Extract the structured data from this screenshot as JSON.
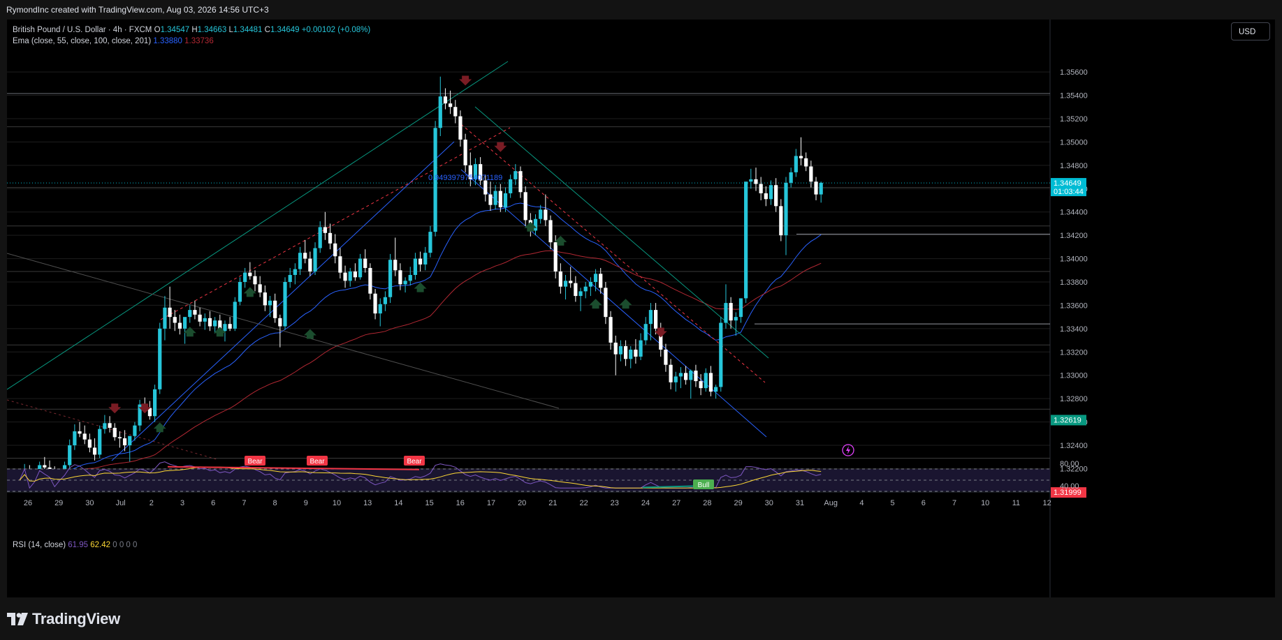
{
  "header": {
    "attribution": "RymondInc created with TradingView.com, Aug 03, 2026 14:56 UTC+3"
  },
  "legend": {
    "symbol": "British Pound / U.S. Dollar · 4h · FXCM",
    "o_label": "O",
    "o": "1.34547",
    "h_label": "H",
    "h": "1.34663",
    "l_label": "L",
    "l": "1.34481",
    "c_label": "C",
    "c": "1.34649",
    "change": "+0.00102 (+0.08%)",
    "ema_label": "Ema (close, 55, close, 100, close, 201)",
    "ema1": "1.33880",
    "ema2": "1.33736"
  },
  "rsi_legend": {
    "label": "RSI (14, close)",
    "v1": "61.95",
    "v2": "62.42",
    "v3": "0  0  0  0"
  },
  "currency_button": "USD",
  "colors": {
    "bull": "#26c6da",
    "bear": "#ffffff",
    "ema55": "#2962ff",
    "ema100": "#b22833",
    "rsi": "#7e57c2",
    "rsi_ma": "#fdd835",
    "accent_green": "#089981",
    "accent_red": "#f23645"
  },
  "footer": {
    "brand": "TradingView"
  },
  "chart_data": {
    "type": "candlestick",
    "price_scale": {
      "min": 1.3185,
      "max": 1.3575,
      "ticks": [
        "1.35600",
        "1.35400",
        "1.35200",
        "1.35000",
        "1.34800",
        "1.34600",
        "1.34400",
        "1.34200",
        "1.34000",
        "1.33800",
        "1.33600",
        "1.33400",
        "1.33200",
        "1.33000",
        "1.32800",
        "1.32600",
        "1.32400",
        "1.32200"
      ]
    },
    "price_labels": [
      {
        "text": "1.34649",
        "sub": "01:03:44",
        "value": 1.34649,
        "color": "#00bcd4"
      },
      {
        "text": "1.32619",
        "value": 1.32619,
        "color": "#089981"
      },
      {
        "text": "1.31999",
        "value": 1.31999,
        "color": "#f23645"
      }
    ],
    "rsi_scale": {
      "ticks": [
        "80.00",
        "40.00"
      ]
    },
    "x_ticks": [
      "26",
      "29",
      "30",
      "Jul",
      "2",
      "3",
      "6",
      "7",
      "8",
      "9",
      "10",
      "13",
      "14",
      "15",
      "16",
      "17",
      "20",
      "21",
      "22",
      "23",
      "24",
      "27",
      "28",
      "29",
      "30",
      "31",
      "Aug",
      "4",
      "5",
      "6",
      "7",
      "10",
      "11",
      "12"
    ],
    "annotation_text": "0.9493979754071189",
    "rsi_signals": [
      {
        "text": "Bear",
        "index": 70
      },
      {
        "text": "Bear",
        "index": 88
      },
      {
        "text": "Bear",
        "index": 116
      },
      {
        "text": "Bull",
        "index": 200
      }
    ],
    "candles": [
      [
        1.3212,
        1.3219,
        1.3209,
        1.3216
      ],
      [
        1.3216,
        1.3224,
        1.3212,
        1.3219
      ],
      [
        1.3219,
        1.3223,
        1.3206,
        1.3211
      ],
      [
        1.3211,
        1.3218,
        1.3205,
        1.3215
      ],
      [
        1.3215,
        1.3226,
        1.3212,
        1.3223
      ],
      [
        1.3223,
        1.323,
        1.3217,
        1.3221
      ],
      [
        1.3221,
        1.3227,
        1.3214,
        1.3219
      ],
      [
        1.3219,
        1.3222,
        1.3205,
        1.321
      ],
      [
        1.321,
        1.3218,
        1.3207,
        1.3216
      ],
      [
        1.3216,
        1.3226,
        1.3213,
        1.3223
      ],
      [
        1.3223,
        1.3245,
        1.322,
        1.324
      ],
      [
        1.324,
        1.3258,
        1.3236,
        1.3252
      ],
      [
        1.3252,
        1.326,
        1.3247,
        1.325
      ],
      [
        1.325,
        1.3257,
        1.3241,
        1.3245
      ],
      [
        1.3245,
        1.325,
        1.3234,
        1.3238
      ],
      [
        1.3238,
        1.3246,
        1.3227,
        1.3232
      ],
      [
        1.3232,
        1.3257,
        1.3229,
        1.3254
      ],
      [
        1.3254,
        1.3266,
        1.325,
        1.3259
      ],
      [
        1.3259,
        1.3265,
        1.3251,
        1.3255
      ],
      [
        1.3255,
        1.3259,
        1.3244,
        1.3247
      ],
      [
        1.3247,
        1.3252,
        1.3238,
        1.3246
      ],
      [
        1.3246,
        1.3253,
        1.3235,
        1.324
      ],
      [
        1.324,
        1.3244,
        1.3226,
        1.3248
      ],
      [
        1.3248,
        1.326,
        1.3244,
        1.3257
      ],
      [
        1.3257,
        1.3279,
        1.3252,
        1.3275
      ],
      [
        1.3275,
        1.3281,
        1.3268,
        1.3272
      ],
      [
        1.3272,
        1.3278,
        1.3262,
        1.3265
      ],
      [
        1.3265,
        1.3292,
        1.326,
        1.3288
      ],
      [
        1.3288,
        1.3345,
        1.3284,
        1.334
      ],
      [
        1.334,
        1.3368,
        1.333,
        1.3358
      ],
      [
        1.3358,
        1.3376,
        1.334,
        1.335
      ],
      [
        1.335,
        1.3356,
        1.3338,
        1.3345
      ],
      [
        1.3345,
        1.3352,
        1.3335,
        1.334
      ],
      [
        1.334,
        1.3348,
        1.3327,
        1.335
      ],
      [
        1.335,
        1.336,
        1.3345,
        1.3356
      ],
      [
        1.3356,
        1.3364,
        1.3348,
        1.3352
      ],
      [
        1.3352,
        1.3358,
        1.3342,
        1.3346
      ],
      [
        1.3346,
        1.3353,
        1.3339,
        1.3349
      ],
      [
        1.3349,
        1.3355,
        1.3338,
        1.3342
      ],
      [
        1.3342,
        1.335,
        1.3336,
        1.3347
      ],
      [
        1.3347,
        1.3352,
        1.3334,
        1.3338
      ],
      [
        1.3338,
        1.3347,
        1.3329,
        1.3344
      ],
      [
        1.3344,
        1.335,
        1.3338,
        1.334
      ],
      [
        1.334,
        1.3367,
        1.3338,
        1.3363
      ],
      [
        1.3363,
        1.3384,
        1.336,
        1.338
      ],
      [
        1.338,
        1.3392,
        1.3375,
        1.3388
      ],
      [
        1.3388,
        1.3397,
        1.3382,
        1.3385
      ],
      [
        1.3385,
        1.339,
        1.3372,
        1.3378
      ],
      [
        1.3378,
        1.3385,
        1.3367,
        1.3371
      ],
      [
        1.3371,
        1.3377,
        1.3355,
        1.336
      ],
      [
        1.336,
        1.3368,
        1.335,
        1.3364
      ],
      [
        1.3364,
        1.337,
        1.3345,
        1.3349
      ],
      [
        1.3349,
        1.3352,
        1.3324,
        1.3342
      ],
      [
        1.3342,
        1.3384,
        1.3339,
        1.338
      ],
      [
        1.338,
        1.3392,
        1.3375,
        1.3386
      ],
      [
        1.3386,
        1.3396,
        1.3378,
        1.3391
      ],
      [
        1.3391,
        1.341,
        1.3386,
        1.3405
      ],
      [
        1.3405,
        1.3416,
        1.3396,
        1.34
      ],
      [
        1.34,
        1.3406,
        1.3385,
        1.3389
      ],
      [
        1.3389,
        1.3414,
        1.3386,
        1.3409
      ],
      [
        1.3409,
        1.3432,
        1.3405,
        1.3427
      ],
      [
        1.3427,
        1.344,
        1.3416,
        1.3422
      ],
      [
        1.3422,
        1.343,
        1.3408,
        1.3413
      ],
      [
        1.3413,
        1.3421,
        1.3396,
        1.3402
      ],
      [
        1.3402,
        1.3409,
        1.3383,
        1.3388
      ],
      [
        1.3388,
        1.3394,
        1.3375,
        1.3381
      ],
      [
        1.3381,
        1.3392,
        1.3376,
        1.3389
      ],
      [
        1.3389,
        1.3396,
        1.3381,
        1.3384
      ],
      [
        1.3384,
        1.3404,
        1.3382,
        1.34
      ],
      [
        1.34,
        1.3408,
        1.3388,
        1.3392
      ],
      [
        1.3392,
        1.3396,
        1.3365,
        1.337
      ],
      [
        1.337,
        1.3374,
        1.3348,
        1.3353
      ],
      [
        1.3353,
        1.3366,
        1.3342,
        1.3361
      ],
      [
        1.3361,
        1.3372,
        1.3355,
        1.3367
      ],
      [
        1.3367,
        1.3404,
        1.3362,
        1.3399
      ],
      [
        1.3399,
        1.3418,
        1.3385,
        1.339
      ],
      [
        1.339,
        1.3396,
        1.3373,
        1.3378
      ],
      [
        1.3378,
        1.3384,
        1.3371,
        1.3381
      ],
      [
        1.3381,
        1.3393,
        1.3377,
        1.3386
      ],
      [
        1.3386,
        1.3405,
        1.3382,
        1.34
      ],
      [
        1.34,
        1.3406,
        1.3389,
        1.3395
      ],
      [
        1.3395,
        1.341,
        1.339,
        1.3405
      ],
      [
        1.3405,
        1.3428,
        1.3401,
        1.3423
      ],
      [
        1.3423,
        1.3518,
        1.3419,
        1.3512
      ],
      [
        1.3512,
        1.3556,
        1.3505,
        1.3539
      ],
      [
        1.3539,
        1.3546,
        1.3528,
        1.3533
      ],
      [
        1.3533,
        1.3544,
        1.3524,
        1.353
      ],
      [
        1.353,
        1.3536,
        1.3516,
        1.3522
      ],
      [
        1.3522,
        1.3527,
        1.3496,
        1.3502
      ],
      [
        1.3502,
        1.3507,
        1.3474,
        1.348
      ],
      [
        1.348,
        1.3491,
        1.3462,
        1.3468
      ],
      [
        1.3468,
        1.3486,
        1.3463,
        1.3481
      ],
      [
        1.3481,
        1.3487,
        1.3463,
        1.3467
      ],
      [
        1.3467,
        1.3472,
        1.3449,
        1.3455
      ],
      [
        1.3455,
        1.3466,
        1.3441,
        1.3446
      ],
      [
        1.3446,
        1.3463,
        1.3442,
        1.3458
      ],
      [
        1.3458,
        1.3464,
        1.344,
        1.3444
      ],
      [
        1.3444,
        1.3461,
        1.344,
        1.3456
      ],
      [
        1.3456,
        1.3472,
        1.3452,
        1.3468
      ],
      [
        1.3468,
        1.3481,
        1.3463,
        1.3475
      ],
      [
        1.3475,
        1.3479,
        1.3452,
        1.3457
      ],
      [
        1.3457,
        1.3462,
        1.3428,
        1.3433
      ],
      [
        1.3433,
        1.3439,
        1.3419,
        1.3424
      ],
      [
        1.3424,
        1.3438,
        1.342,
        1.3434
      ],
      [
        1.3434,
        1.3446,
        1.343,
        1.3442
      ],
      [
        1.3442,
        1.3455,
        1.3428,
        1.3433
      ],
      [
        1.3433,
        1.3437,
        1.3408,
        1.3414
      ],
      [
        1.3414,
        1.342,
        1.3383,
        1.3389
      ],
      [
        1.3389,
        1.3396,
        1.337,
        1.3376
      ],
      [
        1.3376,
        1.3386,
        1.3365,
        1.3381
      ],
      [
        1.3381,
        1.3393,
        1.3375,
        1.3379
      ],
      [
        1.3379,
        1.3385,
        1.3363,
        1.3368
      ],
      [
        1.3368,
        1.3375,
        1.3355,
        1.3372
      ],
      [
        1.3372,
        1.338,
        1.3366,
        1.3376
      ],
      [
        1.3376,
        1.3384,
        1.3368,
        1.338
      ],
      [
        1.338,
        1.3391,
        1.3372,
        1.3387
      ],
      [
        1.3387,
        1.3392,
        1.337,
        1.3375
      ],
      [
        1.3375,
        1.338,
        1.3344,
        1.335
      ],
      [
        1.335,
        1.3355,
        1.3322,
        1.3328
      ],
      [
        1.3328,
        1.3334,
        1.33,
        1.3318
      ],
      [
        1.3318,
        1.333,
        1.3312,
        1.3325
      ],
      [
        1.3325,
        1.333,
        1.3308,
        1.3314
      ],
      [
        1.3314,
        1.3325,
        1.3306,
        1.3322
      ],
      [
        1.3322,
        1.3331,
        1.331,
        1.3316
      ],
      [
        1.3316,
        1.3336,
        1.3313,
        1.333
      ],
      [
        1.333,
        1.335,
        1.3326,
        1.3344
      ],
      [
        1.3344,
        1.3362,
        1.333,
        1.3356
      ],
      [
        1.3356,
        1.3362,
        1.3335,
        1.334
      ],
      [
        1.334,
        1.3345,
        1.3316,
        1.3322
      ],
      [
        1.3322,
        1.3327,
        1.3303,
        1.3309
      ],
      [
        1.3309,
        1.3314,
        1.3288,
        1.3294
      ],
      [
        1.3294,
        1.3303,
        1.3286,
        1.3299
      ],
      [
        1.3299,
        1.3307,
        1.3289,
        1.3302
      ],
      [
        1.3302,
        1.3308,
        1.3292,
        1.3296
      ],
      [
        1.3296,
        1.3305,
        1.328,
        1.3304
      ],
      [
        1.3304,
        1.3309,
        1.329,
        1.3295
      ],
      [
        1.3295,
        1.3301,
        1.3283,
        1.3289
      ],
      [
        1.3289,
        1.3306,
        1.3286,
        1.3302
      ],
      [
        1.3302,
        1.3308,
        1.3282,
        1.3286
      ],
      [
        1.3286,
        1.3292,
        1.328,
        1.329
      ],
      [
        1.329,
        1.335,
        1.3286,
        1.3345
      ],
      [
        1.3345,
        1.3378,
        1.334,
        1.3362
      ],
      [
        1.3362,
        1.3367,
        1.334,
        1.3347
      ],
      [
        1.3347,
        1.3354,
        1.3334,
        1.335
      ],
      [
        1.335,
        1.3362,
        1.3345,
        1.3366
      ],
      [
        1.3366,
        1.3425,
        1.3362,
        1.3466
      ],
      [
        1.3466,
        1.3477,
        1.346,
        1.3468
      ],
      [
        1.3468,
        1.3478,
        1.3458,
        1.3464
      ],
      [
        1.3464,
        1.347,
        1.345,
        1.3456
      ],
      [
        1.3456,
        1.3462,
        1.3445,
        1.3451
      ],
      [
        1.3451,
        1.3467,
        1.3446,
        1.3463
      ],
      [
        1.3463,
        1.3469,
        1.344,
        1.3445
      ],
      [
        1.3445,
        1.3451,
        1.3415,
        1.342
      ],
      [
        1.342,
        1.347,
        1.3403,
        1.3465
      ],
      [
        1.3465,
        1.3478,
        1.3461,
        1.3474
      ],
      [
        1.3474,
        1.3494,
        1.347,
        1.3488
      ],
      [
        1.3488,
        1.3504,
        1.348,
        1.3486
      ],
      [
        1.3486,
        1.3491,
        1.3475,
        1.3479
      ],
      [
        1.3479,
        1.3484,
        1.3461,
        1.3466
      ],
      [
        1.3466,
        1.347,
        1.345,
        1.3455
      ],
      [
        1.3455,
        1.3466,
        1.3448,
        1.3465
      ]
    ]
  }
}
